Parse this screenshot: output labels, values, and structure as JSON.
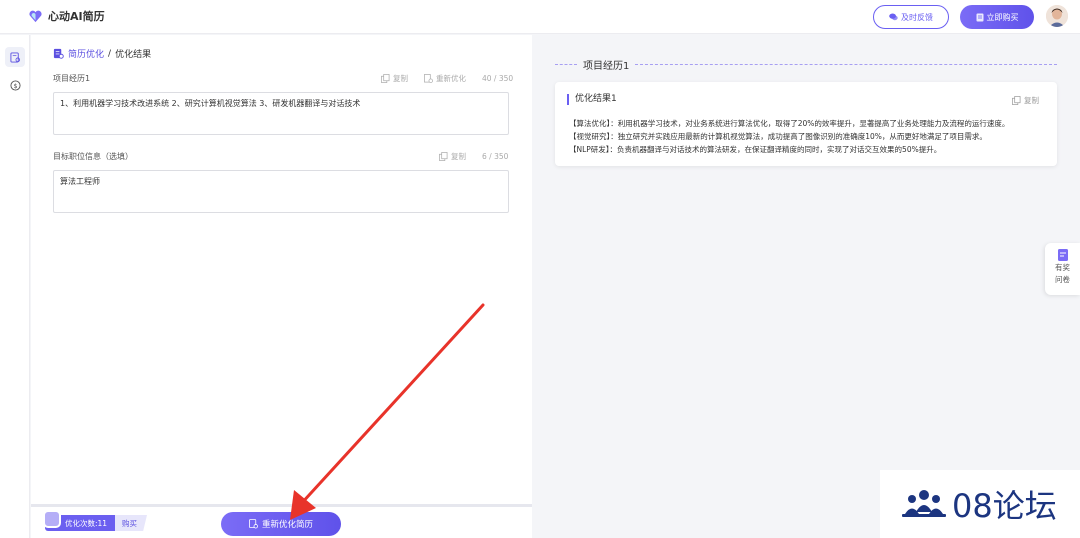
{
  "header": {
    "brand": "心动AI简历",
    "feedback_label": "及时反馈",
    "buy_label": "立即购买"
  },
  "breadcrumb": {
    "link": "简历优化",
    "separator": "/",
    "current": "优化结果"
  },
  "project": {
    "label": "项目经历1",
    "copy_label": "复制",
    "reopt_label": "重新优化",
    "counter": "40 / 350",
    "value": "1、利用机器学习技术改进系统 2、研究计算机视觉算法 3、研发机器翻译与对话技术"
  },
  "target": {
    "label": "目标职位信息（选填）",
    "copy_label": "复制",
    "counter": "6 / 350",
    "value": "算法工程师"
  },
  "footer": {
    "count_label": "优化次数:11",
    "buy_label": "购买",
    "reopt_button": "重新优化简历"
  },
  "result": {
    "section_title": "项目经历1",
    "card_title": "优化结果1",
    "copy_label": "复制",
    "lines": [
      "【算法优化】：利用机器学习技术，对业务系统进行算法优化，取得了20%的效率提升，显著提高了业务处理能力及流程的运行速度。",
      "【视觉研究】：独立研究并实践应用最新的计算机视觉算法，成功提高了图像识别的准确度10%，从而更好地满足了项目需求。",
      "【NLP研发】：负责机器翻译与对话技术的算法研发，在保证翻译精度的同时，实现了对话交互效果的50%提升。"
    ]
  },
  "survey": {
    "line1": "有奖",
    "line2": "问卷"
  },
  "watermark": {
    "text": "08论坛"
  },
  "colors": {
    "accent": "#6a5ff2",
    "arrow": "#e8332a",
    "watermark": "#1c3580"
  }
}
